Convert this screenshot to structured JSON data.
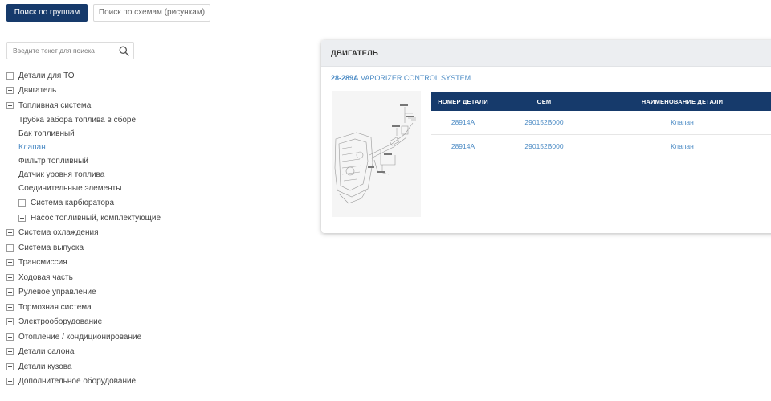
{
  "tabs": {
    "groups_label": "Поиск по группам",
    "schemes_label": "Поиск по схемам (рисункам)"
  },
  "search": {
    "placeholder": "Введите текст для поиска",
    "icon": "search-icon"
  },
  "tree": [
    {
      "label": "Детали для ТО",
      "state": "collapsed"
    },
    {
      "label": "Двигатель",
      "state": "collapsed"
    },
    {
      "label": "Топливная система",
      "state": "expanded"
    },
    {
      "label": "Трубка забора топлива в сборе",
      "state": "leaf"
    },
    {
      "label": "Бак топливный",
      "state": "leaf"
    },
    {
      "label": "Клапан",
      "state": "selected"
    },
    {
      "label": "Фильтр топливный",
      "state": "leaf"
    },
    {
      "label": "Датчик уровня топлива",
      "state": "leaf"
    },
    {
      "label": "Соединительные элементы",
      "state": "leaf"
    },
    {
      "label": "Система карбюратора",
      "state": "collapsed-child"
    },
    {
      "label": "Насос топливный, комплектующие",
      "state": "collapsed-child"
    },
    {
      "label": "Система охлаждения",
      "state": "collapsed"
    },
    {
      "label": "Система выпуска",
      "state": "collapsed"
    },
    {
      "label": "Трансмиссия",
      "state": "collapsed"
    },
    {
      "label": "Ходовая часть",
      "state": "collapsed"
    },
    {
      "label": "Рулевое управление",
      "state": "collapsed"
    },
    {
      "label": "Тормозная система",
      "state": "collapsed"
    },
    {
      "label": "Электрооборудование",
      "state": "collapsed"
    },
    {
      "label": "Отопление / кондиционирование",
      "state": "collapsed"
    },
    {
      "label": "Детали салона",
      "state": "collapsed"
    },
    {
      "label": "Детали кузова",
      "state": "collapsed"
    },
    {
      "label": "Дополнительное оборудование",
      "state": "collapsed"
    }
  ],
  "card": {
    "title": "ДВИГАТЕЛЬ",
    "scheme_code": "28-289A",
    "scheme_name": "VAPORIZER CONTROL SYSTEM",
    "table": {
      "headers": [
        "НОМЕР ДЕТАЛИ",
        "OEM",
        "НАИМЕНОВАНИЕ ДЕТАЛИ"
      ],
      "rows": [
        [
          "28914A",
          "290152B000",
          "Клапан"
        ],
        [
          "28914A",
          "290152B000",
          "Клапан"
        ]
      ]
    }
  },
  "colors": {
    "primary": "#163a6b",
    "link": "#4a8ac4",
    "card_header_bg": "#eceef1"
  }
}
